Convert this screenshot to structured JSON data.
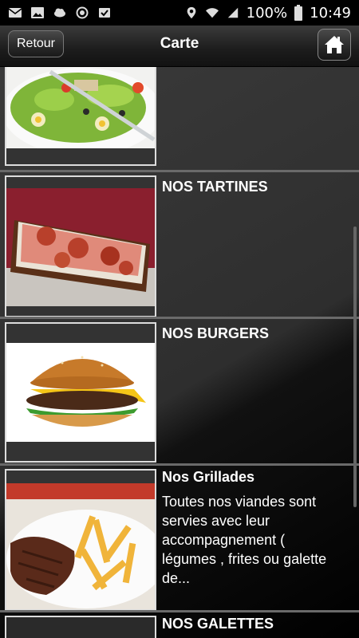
{
  "status": {
    "battery": "100%",
    "time": "10:49"
  },
  "header": {
    "back_label": "Retour",
    "title": "Carte"
  },
  "items": [
    {
      "title": "",
      "desc": ""
    },
    {
      "title": "NOS TARTINES",
      "desc": ""
    },
    {
      "title": "NOS BURGERS",
      "desc": ""
    },
    {
      "title": "Nos Grillades",
      "desc": "Toutes nos viandes sont servies avec leur accompagnement ( légumes , frites ou galette de..."
    },
    {
      "title": "NOS GALETTES",
      "desc": ""
    }
  ]
}
